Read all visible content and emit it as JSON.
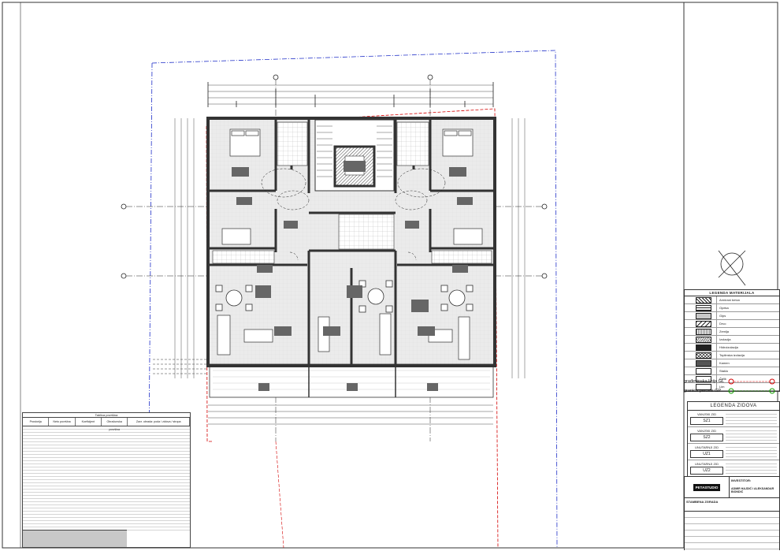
{
  "legend_materials": {
    "title": "LEGENDA MATERIJALA",
    "items": [
      {
        "label": "Armirani beton",
        "pattern": "diagonal"
      },
      {
        "label": "Opeka",
        "pattern": "brick"
      },
      {
        "label": "Gips",
        "pattern": "dots"
      },
      {
        "label": "Drvo",
        "pattern": "wood"
      },
      {
        "label": "Zemlja",
        "pattern": "earth"
      },
      {
        "label": "Izolacija",
        "pattern": "zigzag"
      },
      {
        "label": "Hidroizolacija",
        "pattern": "solid"
      },
      {
        "label": "Toplinska izolacija",
        "pattern": "cross"
      },
      {
        "label": "Kamen",
        "pattern": "stone"
      },
      {
        "label": "Staklo",
        "pattern": "blank"
      },
      {
        "label": "Čelik",
        "pattern": "blank"
      },
      {
        "label": "Lim",
        "pattern": "blank"
      }
    ]
  },
  "line_legend": [
    {
      "label": "građevinska linija GL",
      "color": "#d40000"
    },
    {
      "label": "granica parcele GP",
      "color": "#14a000"
    }
  ],
  "walls_legend": {
    "title": "LEGENDA ZIDOVA",
    "items": [
      {
        "group": "VANJSKI ZID",
        "code": "SZ1"
      },
      {
        "group": "VANJSKI ZID",
        "code": "SZ2"
      },
      {
        "group": "UNUTARNJI ZID",
        "code": "UZ1"
      },
      {
        "group": "UNUTARNJI ZID",
        "code": "UZ2"
      }
    ]
  },
  "title_block": {
    "investor_label": "INVESTITOR:",
    "logo_text": "PETASTUDIO",
    "investor": "ADMIR HAJDIĆ I ALEKSANDAR BIONDIĆ",
    "building": "STAMBENA ZGRADA"
  },
  "area_table": {
    "caption": "Tablica površina",
    "headers": [
      "Prostorija",
      "Neto površina",
      "Koeficijent",
      "Obračunska površina",
      "Zavr. obrada: poda / zidova / stropa"
    ]
  },
  "colors": {
    "building_line": "#d40000",
    "parcel_line": "#2030c8",
    "wall": "#333333"
  }
}
